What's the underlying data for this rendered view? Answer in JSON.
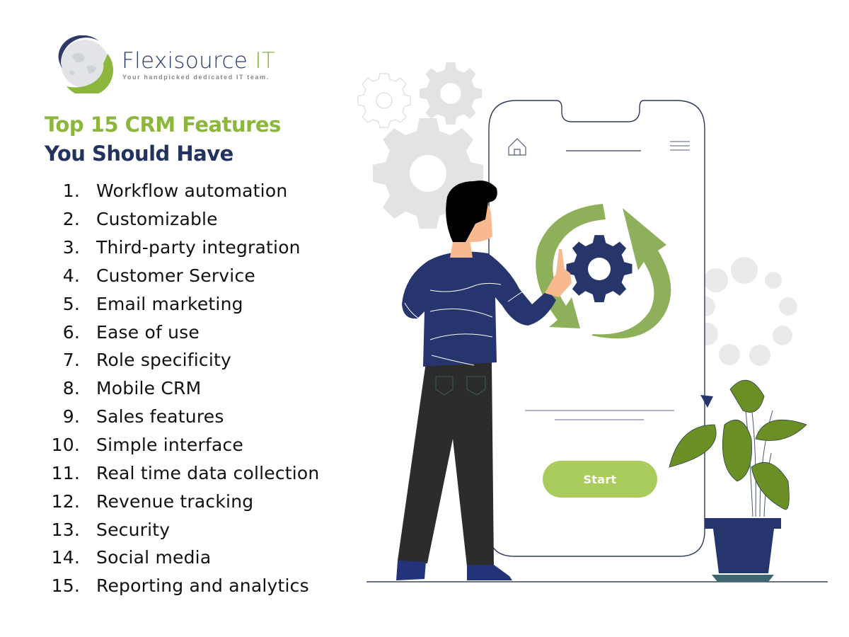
{
  "brand": {
    "name": "Flexisource",
    "name_suffix": "IT",
    "tagline": "Your handpicked dedicated IT team."
  },
  "title": {
    "line1": "Top 15 CRM Features",
    "line2": "You Should Have"
  },
  "features": [
    {
      "num": "1.",
      "label": "Workflow automation"
    },
    {
      "num": "2.",
      "label": "Customizable"
    },
    {
      "num": "3.",
      "label": "Third-party integration"
    },
    {
      "num": "4.",
      "label": "Customer Service"
    },
    {
      "num": "5.",
      "label": "Email marketing"
    },
    {
      "num": "6.",
      "label": "Ease of use"
    },
    {
      "num": "7.",
      "label": "Role specificity"
    },
    {
      "num": "8.",
      "label": "Mobile CRM"
    },
    {
      "num": "9.",
      "label": "Sales features"
    },
    {
      "num": "10.",
      "label": "Simple interface"
    },
    {
      "num": "11.",
      "label": "Real time data collection"
    },
    {
      "num": "12.",
      "label": "Revenue tracking"
    },
    {
      "num": "13.",
      "label": "Security"
    },
    {
      "num": "14.",
      "label": "Social media"
    },
    {
      "num": "15.",
      "label": "Reporting and analytics"
    }
  ],
  "phone": {
    "start_label": "Start",
    "icons": [
      "home-icon",
      "hamburger-menu-icon"
    ]
  },
  "colors": {
    "brand_green": "#8cb63c",
    "brand_navy": "#23335f",
    "button_green": "#a9cc5c",
    "arrow_green": "#8fb05a",
    "gear_grey": "#e3e3e3"
  }
}
